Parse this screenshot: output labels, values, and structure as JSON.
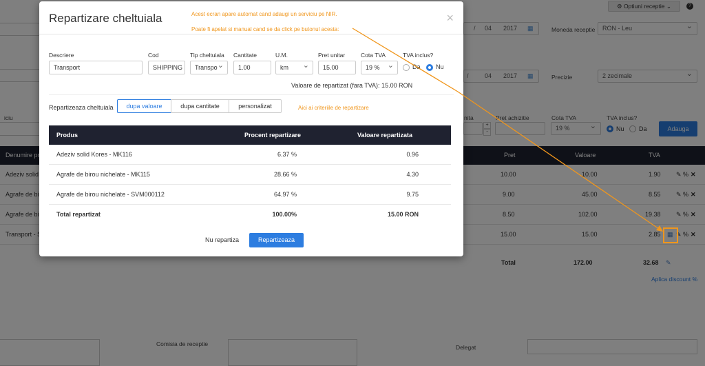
{
  "background": {
    "optiuni_button": "Optiuni receptie",
    "help_icon": "?",
    "date1": {
      "month": "04",
      "year": "2017"
    },
    "date2": {
      "month": "04",
      "year": "2017"
    },
    "moneda_label": "Moneda receptie",
    "moneda_value": "RON - Leu",
    "precizie_label": "Precizie",
    "precizie_value": "2 zecimale",
    "row_labels": {
      "iciu": "iciu",
      "nita": "nita",
      "pret_achizitie": "Pret achizitie",
      "cota_tva": "Cota TVA",
      "tva_inclus": "TVA inclus?"
    },
    "cota_value": "19 %",
    "radio_nu": "Nu",
    "radio_da": "Da",
    "adauga_button": "Adauga",
    "table_head": {
      "denumire": "Denumire pr",
      "pret": "Pret",
      "valoare": "Valoare",
      "tva": "TVA"
    },
    "rows": [
      {
        "name": "Adeziv solid",
        "pret": "10.00",
        "valoare": "10.00",
        "tva": "1.90"
      },
      {
        "name": "Agrafe de bir",
        "pret": "9.00",
        "valoare": "45.00",
        "tva": "8.55"
      },
      {
        "name": "Agrafe de bir",
        "pret": "8.50",
        "valoare": "102.00",
        "tva": "19.38"
      },
      {
        "name": "Transport - S",
        "pret": "15.00",
        "valoare": "15.00",
        "tva": "2.85"
      }
    ],
    "total_label": "Total",
    "total_valoare": "172.00",
    "total_tva": "32.68",
    "discount_link": "Aplica discount %",
    "comisia_label": "Comisia de receptie",
    "delegat_label": "Delegat"
  },
  "modal": {
    "title": "Repartizare cheltuiala",
    "close_icon": "×",
    "note1": "Acest ecran apare automat cand adaugi un serviciu pe NIR.",
    "note2": "Poate fi apelat si manual cand se da click pe butonul acesta:",
    "note3": "Aici ai criteriile de repartizare",
    "fields": {
      "descriere_label": "Descriere",
      "descriere_value": "Transport",
      "cod_label": "Cod",
      "cod_value": "SHIPPING",
      "tip_label": "Tip cheltuiala",
      "tip_value": "Transpo",
      "cantitate_label": "Cantitate",
      "cantitate_value": "1.00",
      "um_label": "U.M.",
      "um_value": "km",
      "pret_label": "Pret unitar",
      "pret_value": "15.00",
      "cota_label": "Cota TVA",
      "cota_value": "19 %",
      "tva_inclus_label": "TVA inclus?",
      "da_label": "Da",
      "nu_label": "Nu"
    },
    "valoare_repartizat": "Valoare de repartizat (fara TVA):  15.00 RON",
    "repartizeaza_label": "Repartizeaza cheltuiala",
    "tabs": [
      "dupa valoare",
      "dupa cantitate",
      "personalizat"
    ],
    "table": {
      "headers": [
        "Produs",
        "Procent repartizare",
        "Valoare repartizata"
      ],
      "rows": [
        {
          "produs": "Adeziv solid Kores - MK116",
          "procent": "6.37 %",
          "valoare": "0.96"
        },
        {
          "produs": "Agrafe de birou nichelate - MK115",
          "procent": "28.66 %",
          "valoare": "4.30"
        },
        {
          "produs": "Agrafe de birou nichelate - SVM000112",
          "procent": "64.97 %",
          "valoare": "9.75"
        }
      ],
      "total": {
        "produs": "Total repartizat",
        "procent": "100.00%",
        "valoare": "15.00 RON"
      }
    },
    "cancel_button": "Nu repartiza",
    "ok_button": "Repartizeaza"
  },
  "colors": {
    "accent": "#2d7de0",
    "annotation": "#f0961c",
    "table_header": "#1f2230"
  }
}
